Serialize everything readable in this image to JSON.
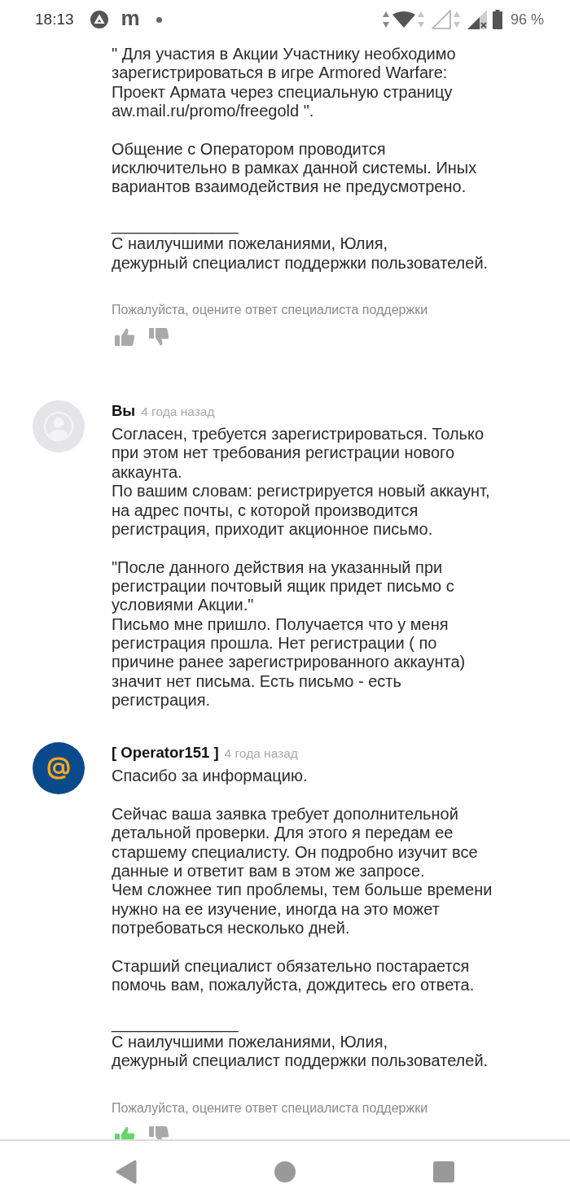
{
  "status_bar": {
    "time": "18:13",
    "app_letter": "m",
    "battery": "96 %"
  },
  "messages": [
    {
      "kind": "continued",
      "paragraphs": [
        "\" Для участия в Акции Участнику необходимо\nзарегистрироваться в игре Armored Warfare:\nПроект Армата через специальную страницу\naw.mail.ru/promo/freegold \".",
        "Общение с Оператором проводится\nисключительно в рамках данной системы. Иных\nвариантов взаимодействия не предусмотрено."
      ],
      "signature": "______________\nС наилучшими пожеланиями, Юлия,\nдежурный специалист поддержки пользователей.",
      "rating": {
        "prompt": "Пожалуйста, оцените ответ специалиста поддержки",
        "buttons": [
          {
            "kind": "like",
            "selected": false
          },
          {
            "kind": "dislike",
            "selected": false
          }
        ]
      }
    },
    {
      "kind": "user",
      "author": "Вы",
      "time": "4 года назад",
      "paragraphs": [
        "Согласен, требуется зарегистрироваться. Только\nпри этом нет требования регистрации нового\nаккаунта.\nПо вашим словам: регистрируется новый аккаунт,\nна адрес почты, с которой производится\nрегистрация, приходит акционное письмо.",
        "\"После данного действия на указанный при\nрегистрации почтовый ящик придет письмо с\nусловиями Акции.\"\nПисьмо мне пришло. Получается что у меня\nрегистрация прошла. Нет регистрации ( по\nпричине ранее зарегистрированного аккаунта)\nзначит нет письма. Есть письмо - есть\nрегистрация."
      ]
    },
    {
      "kind": "operator",
      "author": "[ Operator151 ]",
      "time": "4 года назад",
      "paragraphs": [
        "Спасибо за информацию.",
        "Сейчас ваша заявка требует дополнительной\nдетальной проверки. Для этого я передам ее\nстаршему специалисту. Он подробно изучит все\nданные и ответит вам в этом же запросе.\nЧем сложнее тип проблемы, тем больше времени\nнужно на ее изучение, иногда на это может\nпотребоваться несколько дней.",
        "Старший специалист обязательно постарается\nпомочь вам, пожалуйста, дождитесь его ответа."
      ],
      "signature": "______________\nС наилучшими пожеланиями, Юлия,\nдежурный специалист поддержки пользователей.",
      "rating": {
        "prompt": "Пожалуйста, оцените ответ специалиста поддержки",
        "buttons": [
          {
            "kind": "like",
            "selected": true
          },
          {
            "kind": "dislike",
            "selected": false
          }
        ]
      }
    }
  ]
}
